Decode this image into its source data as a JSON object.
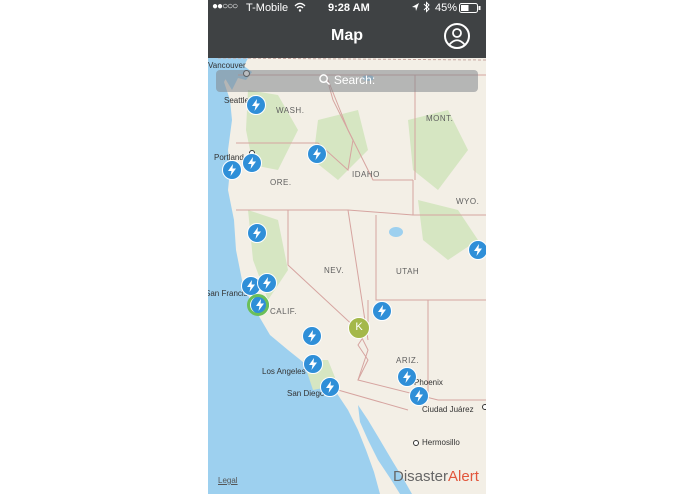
{
  "status_bar": {
    "carrier": "T-Mobile",
    "time": "9:28 AM",
    "battery": "45%",
    "icons": [
      "signal-dots-icon",
      "wifi-icon",
      "location-arrow-icon",
      "bluetooth-icon",
      "battery-icon"
    ]
  },
  "header": {
    "title": "Map",
    "profile_icon": "user-circle-icon"
  },
  "search": {
    "placeholder": "Search:",
    "icon": "search-icon"
  },
  "map": {
    "state_labels": [
      "WASH.",
      "MONT.",
      "IDAHO",
      "ORE.",
      "WYO.",
      "NEV.",
      "UTAH",
      "CALIF.",
      "ARIZ."
    ],
    "city_labels": [
      "Seattle",
      "Portland",
      "San Francisco",
      "Los Angeles",
      "San Diego",
      "Phoenix",
      "Ciudad Juárez",
      "Hermosillo",
      "Vancouver"
    ],
    "alert_pin_icon": "lightning-bolt-icon",
    "cluster_label": "K"
  },
  "footer": {
    "legal": "Legal",
    "brand_part1": "Disaster",
    "brand_part2": "Alert"
  },
  "colors": {
    "header": "#3f4244",
    "pin": "#2f8fd8",
    "cluster": "#a4b84a",
    "water": "#9dd0ef",
    "land": "#f3efe6",
    "brand_accent": "#e2553b"
  }
}
